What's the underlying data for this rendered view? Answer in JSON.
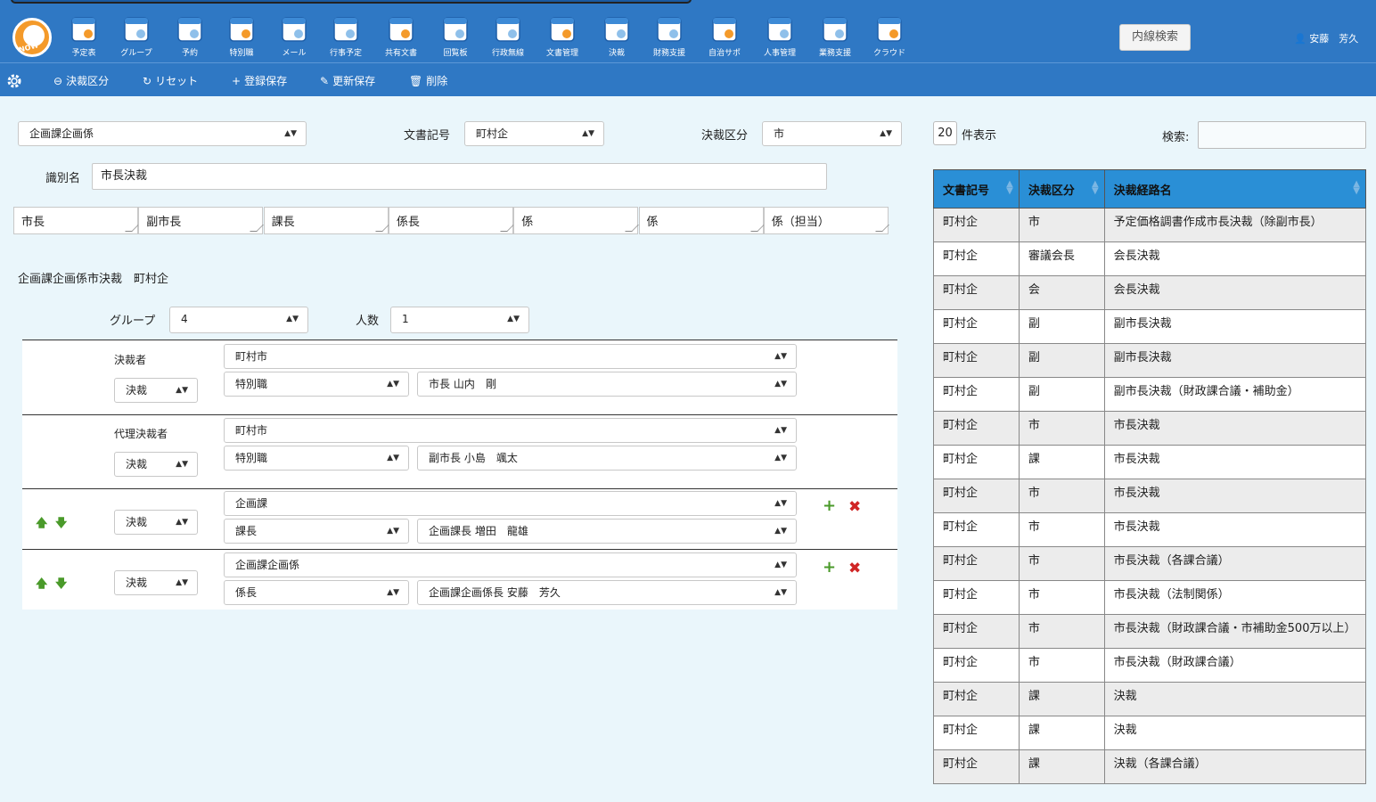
{
  "nav": {
    "items": [
      {
        "label": "予定表",
        "icon": "calendar-clock-icon"
      },
      {
        "label": "グループ",
        "icon": "group-icon"
      },
      {
        "label": "予約",
        "icon": "reservation-icon"
      },
      {
        "label": "特別職",
        "icon": "special-staff-icon"
      },
      {
        "label": "メール",
        "icon": "mail-icon"
      },
      {
        "label": "行事予定",
        "icon": "event-calendar-icon"
      },
      {
        "label": "共有文書",
        "icon": "shared-documents-icon"
      },
      {
        "label": "回覧板",
        "icon": "circular-board-icon"
      },
      {
        "label": "行政無線",
        "icon": "speaker-icon"
      },
      {
        "label": "文書管理",
        "icon": "document-management-icon"
      },
      {
        "label": "決裁",
        "icon": "approval-check-icon"
      },
      {
        "label": "財務支援",
        "icon": "finance-icon"
      },
      {
        "label": "自治サポ",
        "icon": "community-support-icon"
      },
      {
        "label": "人事管理",
        "icon": "personnel-icon"
      },
      {
        "label": "業務支援",
        "icon": "business-grid-icon"
      },
      {
        "label": "クラウド",
        "icon": "cloud-icon"
      }
    ],
    "intercom_button": "内線検索",
    "user_name": "安藤　芳久"
  },
  "toolbar": {
    "approval_category": "決裁区分",
    "reset": "リセット",
    "register_save": "登録保存",
    "update_save": "更新保存",
    "delete": "削除"
  },
  "form": {
    "department_select": "企画課企画係",
    "doc_symbol_label": "文書記号",
    "doc_symbol_value": "町村企",
    "category_label": "決裁区分",
    "category_value": "市",
    "identifier_label": "識別名",
    "identifier_value": "市長決裁",
    "route_boxes": [
      "市長",
      "副市長",
      "課長",
      "係長",
      "係",
      "係",
      "係（担当）"
    ],
    "summary_text": "企画課企画係市決裁　町村企",
    "group_label": "グループ",
    "group_value": "4",
    "people_label": "人数",
    "people_value": "1"
  },
  "approvers": [
    {
      "title": "決裁者",
      "type": "決裁",
      "org": "町村市",
      "position": "特別職",
      "person": "市長 山内　剛"
    },
    {
      "title": "代理決裁者",
      "type": "決裁",
      "org": "町村市",
      "position": "特別職",
      "person": "副市長 小島　颯太"
    },
    {
      "title": "",
      "type": "決裁",
      "org": "企画課",
      "position": "課長",
      "person": "企画課長 増田　龍雄"
    },
    {
      "title": "",
      "type": "決裁",
      "org": "企画課企画係",
      "position": "係長",
      "person": "企画課企画係長 安藤　芳久"
    }
  ],
  "list": {
    "page_size": "20",
    "page_size_suffix": "件表示",
    "search_label": "検索:",
    "headers": [
      "文書記号",
      "決裁区分",
      "決裁経路名"
    ],
    "rows": [
      [
        "町村企",
        "市",
        "予定価格調書作成市長決裁（除副市長）"
      ],
      [
        "町村企",
        "審議会長",
        "会長決裁"
      ],
      [
        "町村企",
        "会",
        "会長決裁"
      ],
      [
        "町村企",
        "副",
        "副市長決裁"
      ],
      [
        "町村企",
        "副",
        "副市長決裁"
      ],
      [
        "町村企",
        "副",
        "副市長決裁（財政課合議・補助金）"
      ],
      [
        "町村企",
        "市",
        "市長決裁"
      ],
      [
        "町村企",
        "課",
        "市長決裁"
      ],
      [
        "町村企",
        "市",
        "市長決裁"
      ],
      [
        "町村企",
        "市",
        "市長決裁"
      ],
      [
        "町村企",
        "市",
        "市長決裁（各課合議）"
      ],
      [
        "町村企",
        "市",
        "市長決裁（法制関係）"
      ],
      [
        "町村企",
        "市",
        "市長決裁（財政課合議・市補助金500万以上）"
      ],
      [
        "町村企",
        "市",
        "市長決裁（財政課合議）"
      ],
      [
        "町村企",
        "課",
        "決裁"
      ],
      [
        "町村企",
        "課",
        "決裁"
      ],
      [
        "町村企",
        "課",
        "決裁（各課合議）"
      ]
    ]
  }
}
